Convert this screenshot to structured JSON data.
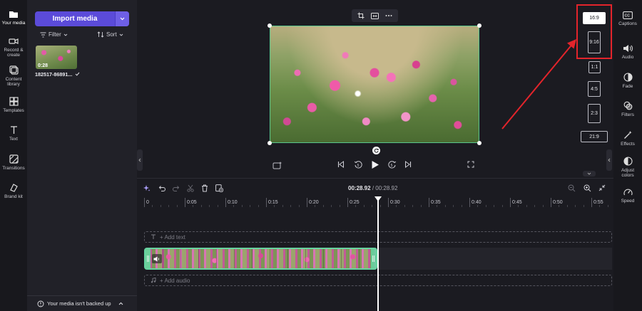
{
  "left_nav": {
    "items": [
      {
        "label": "Your media",
        "icon": "folder-icon"
      },
      {
        "label": "Record & create",
        "icon": "camera-icon"
      },
      {
        "label": "Content library",
        "icon": "library-icon"
      },
      {
        "label": "Templates",
        "icon": "templates-icon"
      },
      {
        "label": "Text",
        "icon": "text-icon"
      },
      {
        "label": "Transitions",
        "icon": "transitions-icon"
      },
      {
        "label": "Brand kit",
        "icon": "brand-kit-icon"
      }
    ]
  },
  "media_panel": {
    "import_label": "Import media",
    "filter_label": "Filter",
    "sort_label": "Sort",
    "thumbnail": {
      "duration": "0:28",
      "name": "182517-86891..."
    },
    "backup_text": "Your media isn't backed up"
  },
  "preview": {
    "aspect_ratios": [
      "16:9",
      "9:16",
      "1:1",
      "4:5",
      "2:3",
      "21:9"
    ],
    "selected_ratio": "16:9"
  },
  "right_nav": {
    "items": [
      {
        "label": "Captions",
        "icon": "captions-icon"
      },
      {
        "label": "Audio",
        "icon": "audio-icon"
      },
      {
        "label": "Fade",
        "icon": "fade-icon"
      },
      {
        "label": "Filters",
        "icon": "filters-icon"
      },
      {
        "label": "Effects",
        "icon": "effects-icon"
      },
      {
        "label": "Adjust colors",
        "icon": "adjust-colors-icon"
      },
      {
        "label": "Speed",
        "icon": "speed-icon"
      }
    ]
  },
  "timeline": {
    "current_time": "00:28.92",
    "separator": " / ",
    "total_time": "00:28.92",
    "ruler_labels": [
      "0",
      "0:05",
      "0:10",
      "0:15",
      "0:20",
      "0:25",
      "0:30",
      "0:35",
      "0:40",
      "0:45",
      "0:50",
      "0:55"
    ],
    "add_text_label": "+ Add text",
    "add_audio_label": "+ Add audio"
  },
  "colors": {
    "accent": "#5b4bd9",
    "clip_border": "#66d3a0",
    "annotation_red": "#e3242b"
  }
}
